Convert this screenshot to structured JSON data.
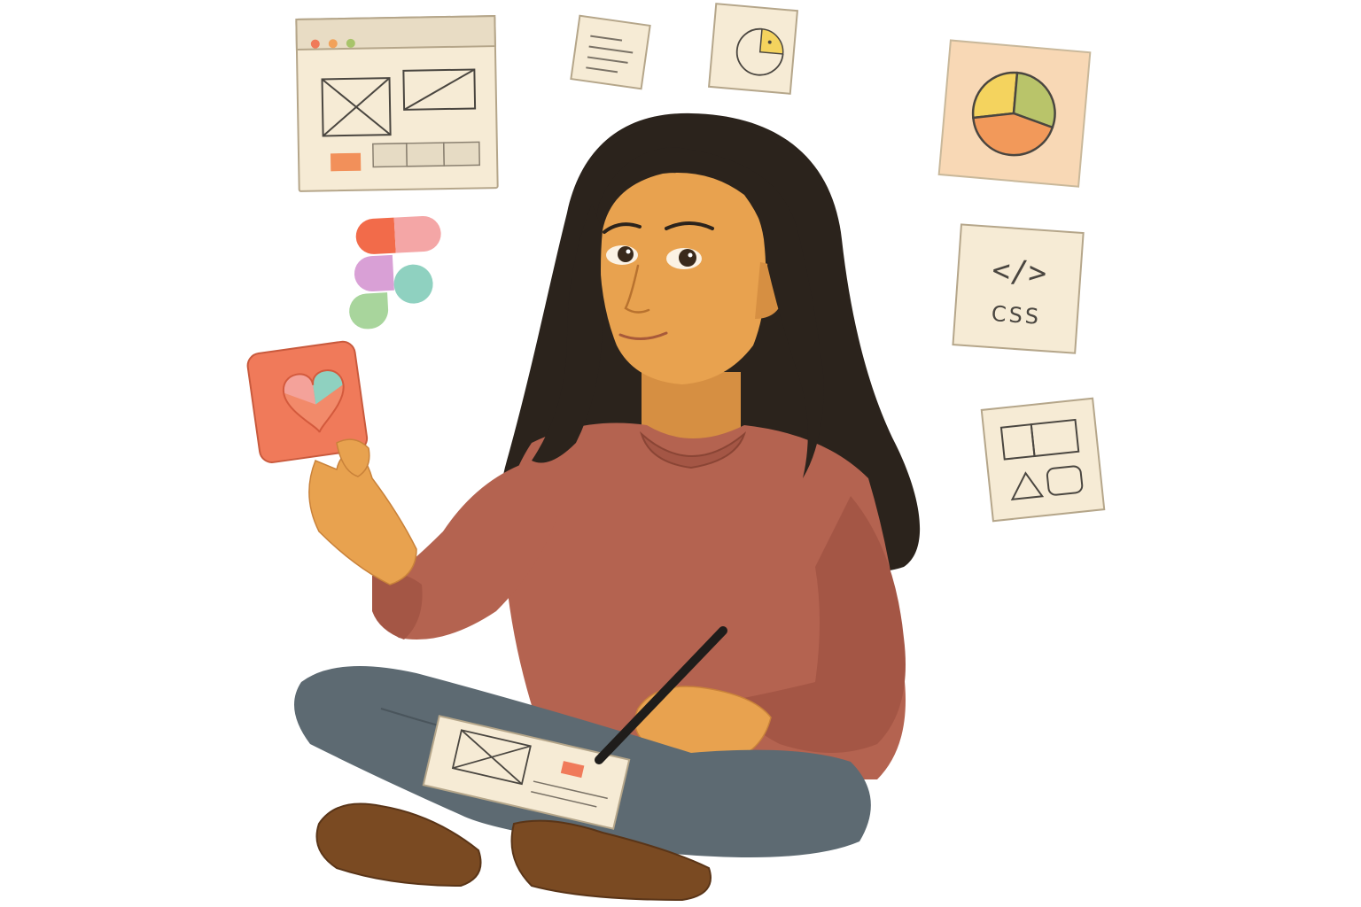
{
  "scene": {
    "background": "#ffffff",
    "palette": {
      "paper": "#f6ebd5",
      "paper_edge": "#c9b89a",
      "ink": "#4a4640",
      "skin": "#e8a24f",
      "skin_shadow": "#c9823a",
      "hair": "#2b231c",
      "sweater": "#b46350",
      "sweater_shadow": "#97503f",
      "jeans": "#5d6a72",
      "boots": "#7a4a22",
      "coral": "#f07a5a",
      "pie_yellow": "#f4d35e",
      "pie_green": "#b9c46a",
      "pie_orange": "#f2995a",
      "figma_red": "#f26b4a",
      "figma_pink": "#f4a6a6",
      "figma_purple": "#d9a0d6",
      "figma_teal": "#8fd1c0",
      "figma_green": "#a8d59c"
    }
  },
  "cards": {
    "code_card": {
      "code_symbol": "</>",
      "label": "CSS"
    }
  }
}
